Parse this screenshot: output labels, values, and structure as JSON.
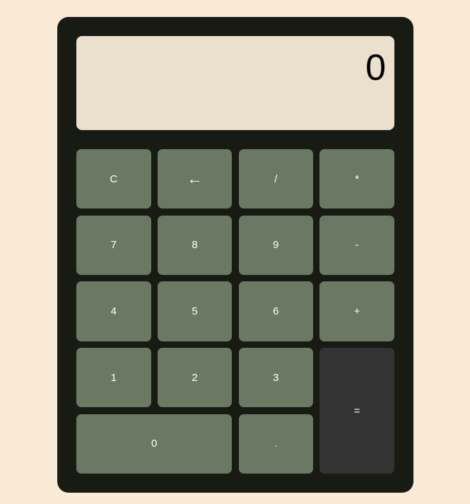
{
  "display": {
    "value": "0"
  },
  "keys": {
    "clear": "C",
    "backspace": "←",
    "divide": "/",
    "multiply": "*",
    "seven": "7",
    "eight": "8",
    "nine": "9",
    "minus": "-",
    "four": "4",
    "five": "5",
    "six": "6",
    "plus": "+",
    "one": "1",
    "two": "2",
    "three": "3",
    "equals": "=",
    "zero": "0",
    "decimal": "."
  },
  "colors": {
    "page_background": "#f9ead6",
    "body": "#181a14",
    "display_background": "#ebdfcd",
    "key": "#6b7864",
    "equals_key": "#333333",
    "key_text": "#ffffff"
  }
}
